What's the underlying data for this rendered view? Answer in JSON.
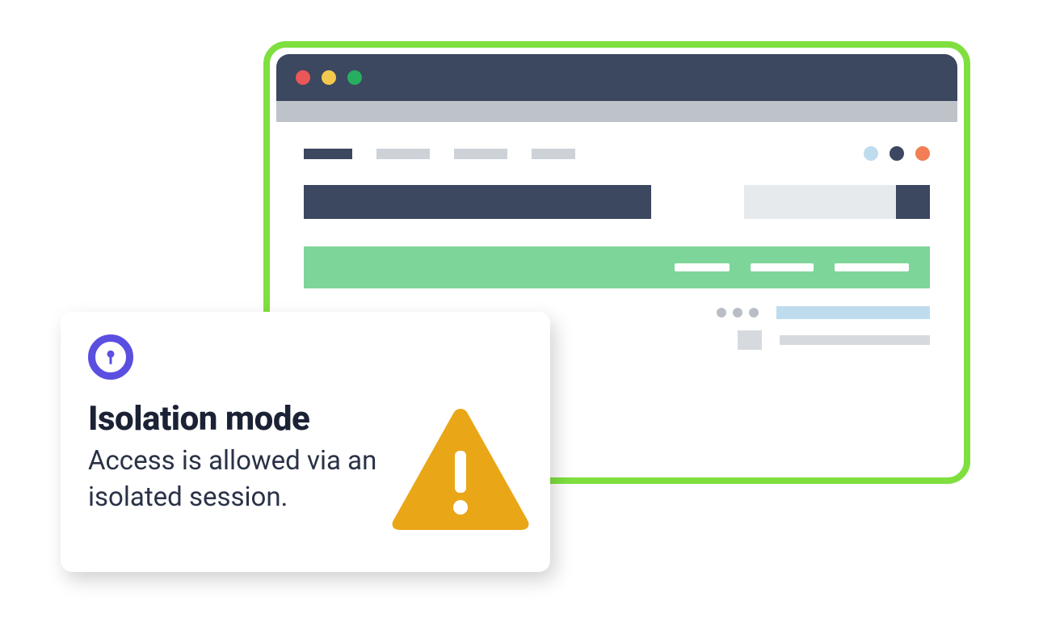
{
  "colors": {
    "frame_outline": "#7FDF3E",
    "titlebar": "#3C4760",
    "urlbar": "#BEC3CA",
    "accent_green": "#7ED59A",
    "accent_blue_light": "#BFDCEF",
    "accent_orange": "#F27E55",
    "lock_ring": "#5A4FE0",
    "warning": "#E9A617",
    "text_title": "#1B2235",
    "text_body": "#2A3247"
  },
  "callout": {
    "title": "Isolation mode",
    "message": "Access is allowed via an isolated session."
  },
  "icons": {
    "lock": "lock-icon",
    "warning": "warning-triangle-icon",
    "traffic_red": "close-icon",
    "traffic_yellow": "minimize-icon",
    "traffic_green": "maximize-icon"
  }
}
